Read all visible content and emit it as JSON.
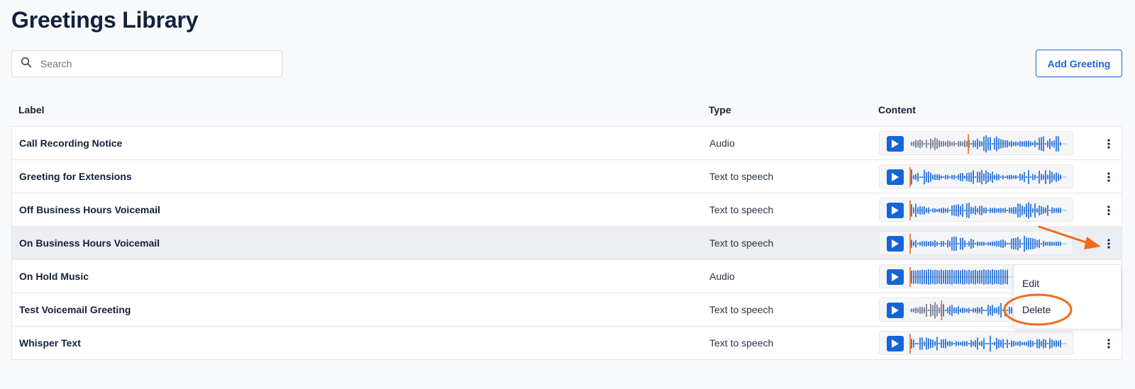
{
  "page": {
    "title": "Greetings Library"
  },
  "search": {
    "placeholder": "Search",
    "icon": "search-icon"
  },
  "toolbar": {
    "add_label": "Add Greeting"
  },
  "table": {
    "columns": [
      "Label",
      "Type",
      "Content"
    ],
    "rows": [
      {
        "label": "Call Recording Notice",
        "type": "Audio",
        "playhead": 0.37
      },
      {
        "label": "Greeting for Extensions",
        "type": "Text to speech",
        "playhead": 0.0
      },
      {
        "label": "Off Business Hours Voicemail",
        "type": "Text to speech",
        "playhead": 0.0
      },
      {
        "label": "On Business Hours Voicemail",
        "type": "Text to speech",
        "playhead": 0.0
      },
      {
        "label": "On Hold Music",
        "type": "Audio",
        "playhead": 0.0
      },
      {
        "label": "Test Voicemail Greeting",
        "type": "Text to speech",
        "playhead": 0.2
      },
      {
        "label": "Whisper Text",
        "type": "Text to speech",
        "playhead": 0.0
      }
    ]
  },
  "context_menu": {
    "items": [
      "Edit",
      "Delete"
    ]
  },
  "colors": {
    "accent": "#1565d8",
    "wave_played": "#6b7280",
    "playhead": "#f26b1d",
    "annotation": "#f26b1d"
  }
}
